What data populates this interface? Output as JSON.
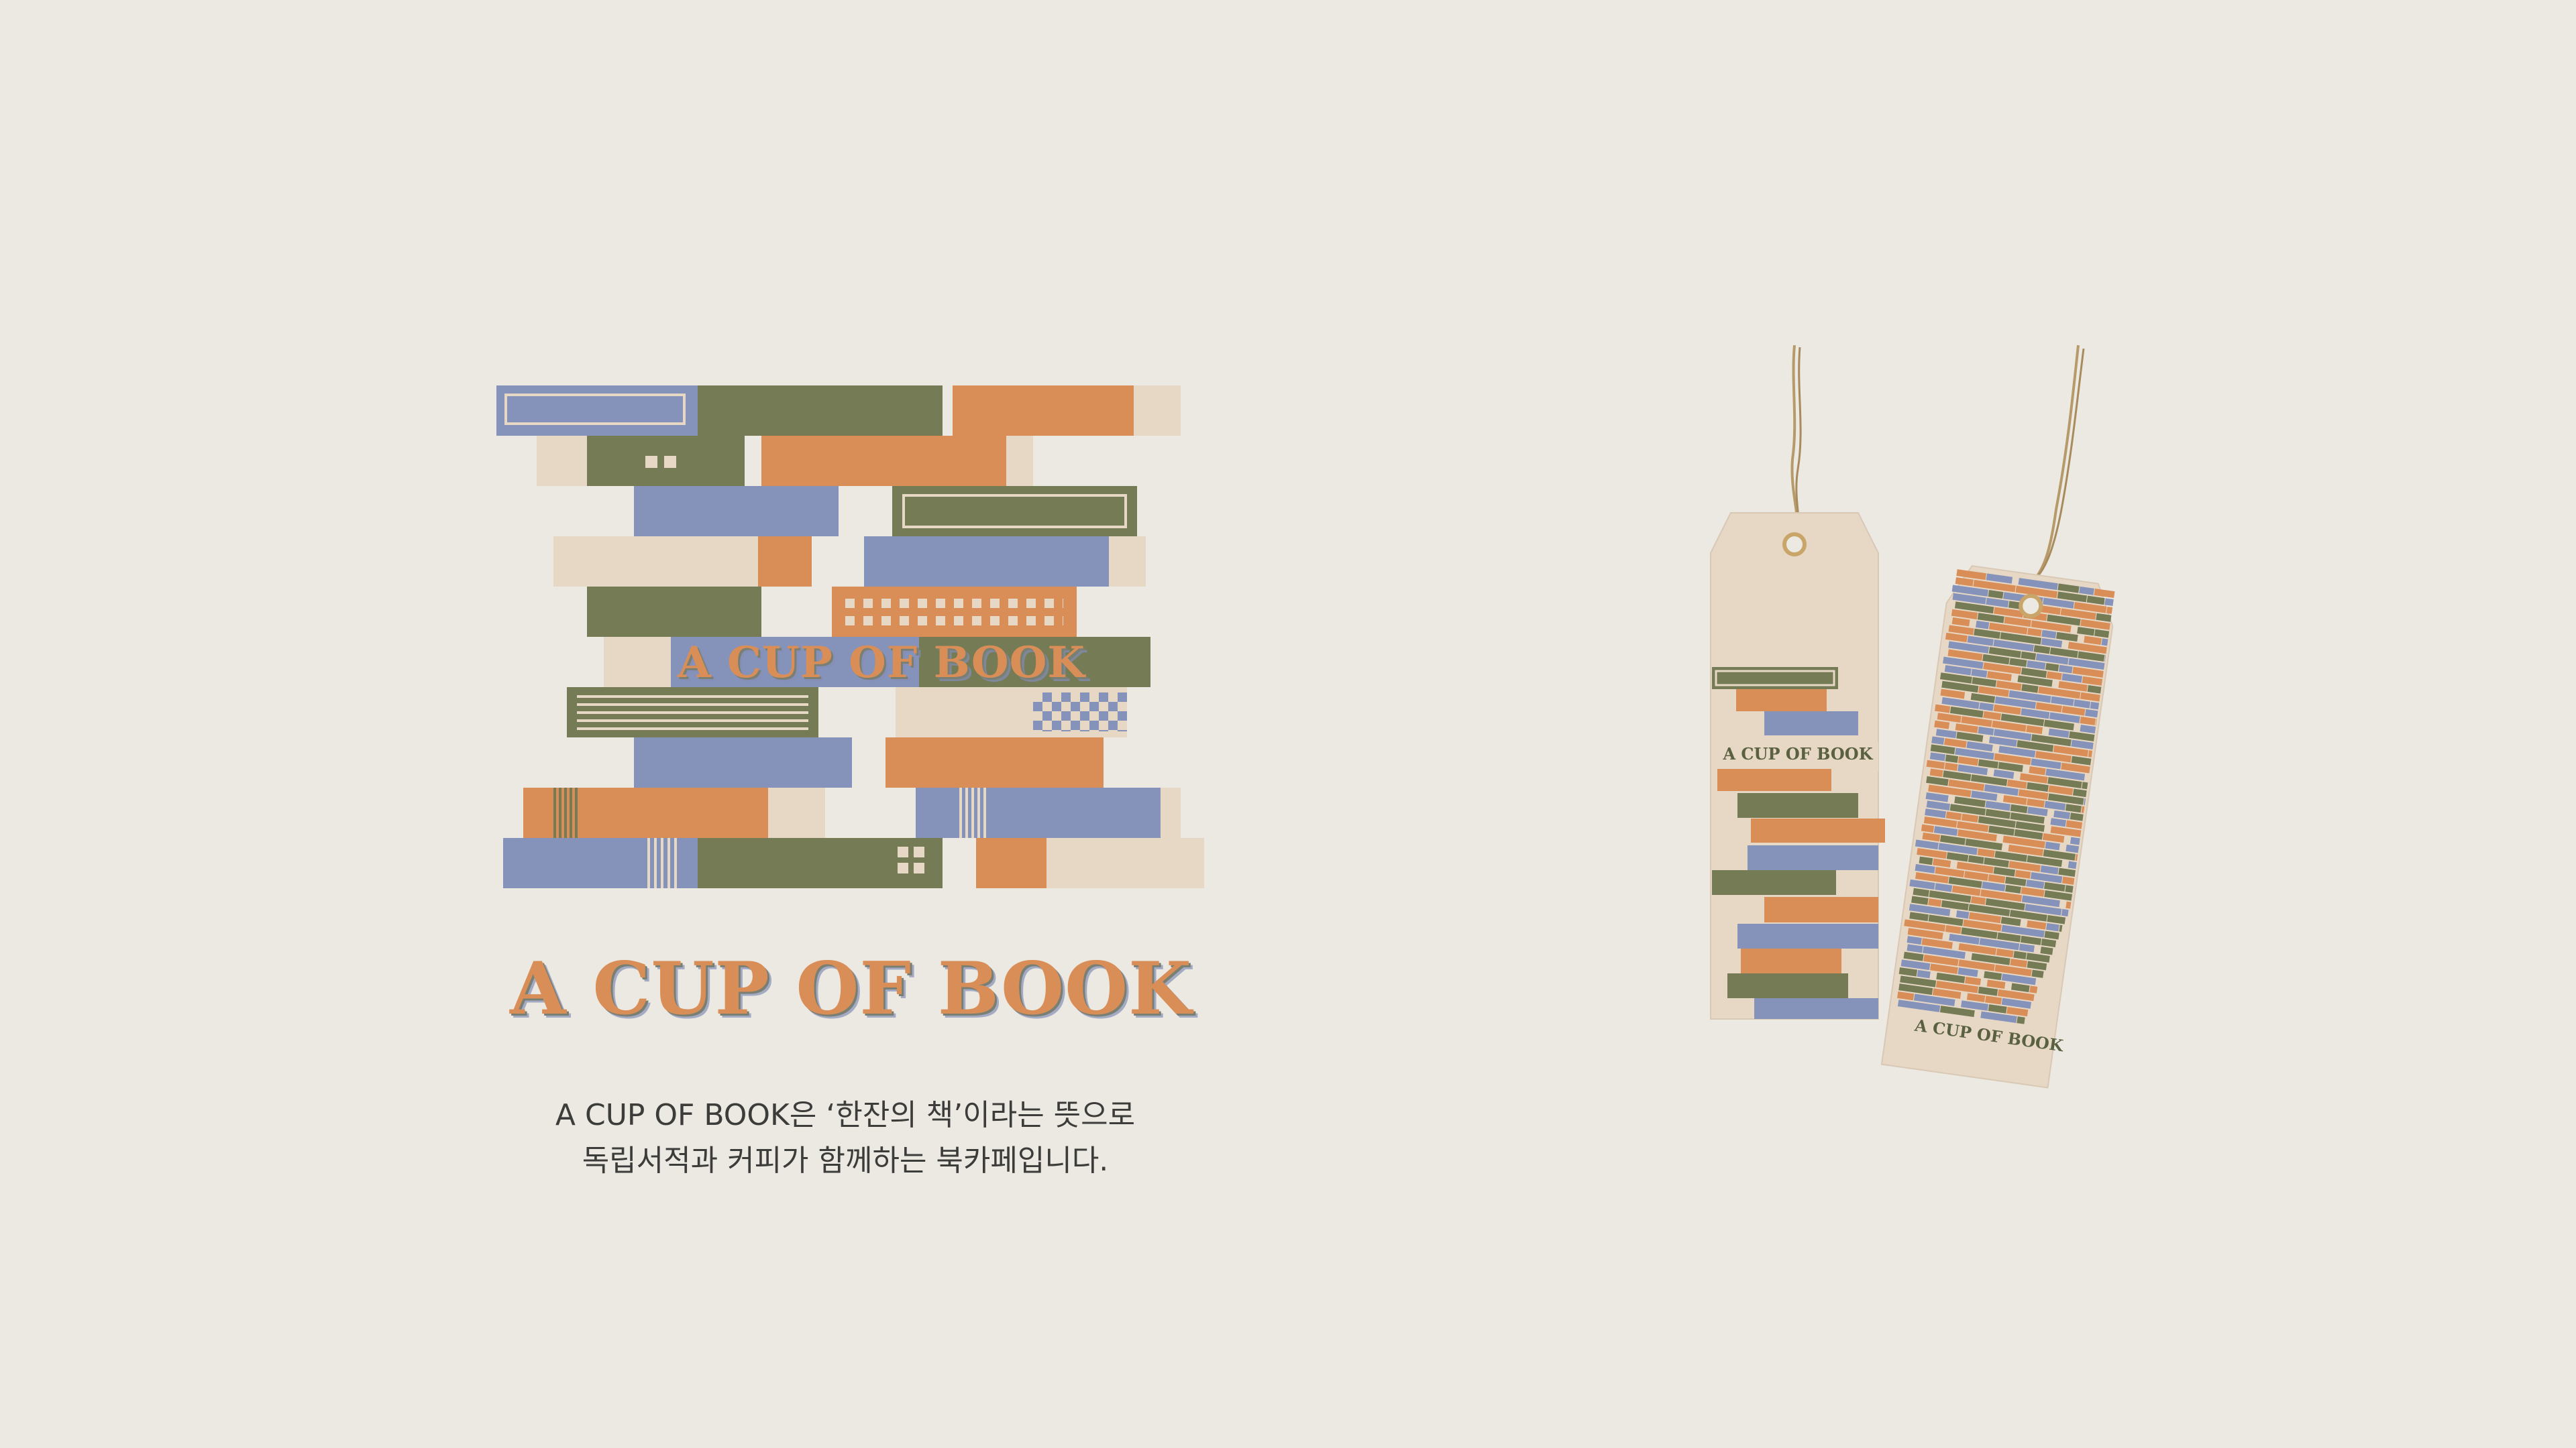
{
  "brand": {
    "name": "A CUP OF BOOK",
    "art_title": "A CUP OF BOOK"
  },
  "intro": {
    "line1": "A CUP OF BOOK은 ‘한잔의 책’이라는 뜻으로",
    "line2": "독립서적과 커피가 함께하는 북카페입니다."
  },
  "tags": {
    "left_tag_label": "A CUP OF BOOK",
    "right_tag_label": "A CUP OF BOOK"
  },
  "colors": {
    "background": "#ece9e2",
    "orange": "#d98e58",
    "olive": "#747b55",
    "blue": "#8592b9",
    "cream": "#e7d8c6",
    "twine": "#b79a6a"
  },
  "icons": {
    "string": "twine-string-icon",
    "eyelet": "eyelet-icon"
  }
}
